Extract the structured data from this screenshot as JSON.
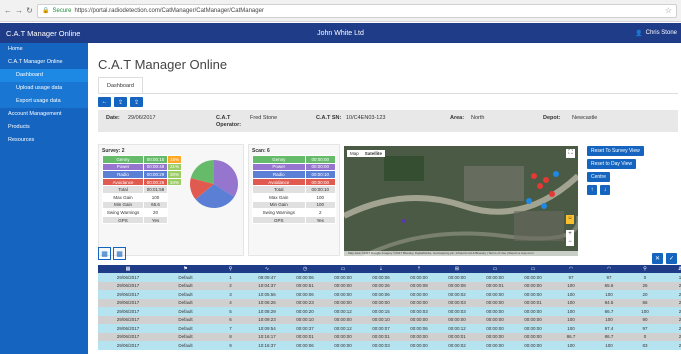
{
  "browser": {
    "secure_label": "Secure",
    "url": "https://portal.radiodetection.com/CatManager/CatManager/CatManager"
  },
  "topbar": {
    "brand": "C.A.T Manager Online",
    "center": "John White Ltd",
    "user": "Chris Stone"
  },
  "sidebar": {
    "items": [
      {
        "label": "Home",
        "level": 0,
        "active": false
      },
      {
        "label": "C.A.T Manager Online",
        "level": 0,
        "active": false
      },
      {
        "label": "Dashboard",
        "level": 1,
        "active": true
      },
      {
        "label": "Upload usage data",
        "level": 1,
        "active": false
      },
      {
        "label": "Export usage data",
        "level": 1,
        "active": false
      },
      {
        "label": "Account Management",
        "level": 0,
        "active": false
      },
      {
        "label": "Products",
        "level": 0,
        "active": false
      },
      {
        "label": "Resources",
        "level": 0,
        "active": false
      }
    ]
  },
  "page": {
    "title": "C.A.T Manager Online",
    "tab": "Dashboard"
  },
  "info": {
    "date_label": "Date:",
    "date": "29/06/2017",
    "operator_label": "C.A.T Operator:",
    "operator": "Fred Stone",
    "sn_label": "C.A.T SN:",
    "sn": "10/C4EN03-123",
    "area_label": "Area:",
    "area": "North",
    "depot_label": "Depot:",
    "depot": "Newcastle"
  },
  "survey": {
    "title": "Survey: 2",
    "modes": [
      {
        "name": "Genny",
        "time": "00:00:15",
        "pct": "15%"
      },
      {
        "name": "Power",
        "time": "00:00:48",
        "pct": "21%"
      },
      {
        "name": "Radio",
        "time": "00:00:29",
        "pct": "30%"
      },
      {
        "name": "Avoidance",
        "time": "00:00:26",
        "pct": "34%"
      }
    ],
    "stats": [
      {
        "label": "Total",
        "value": "00:01:58"
      },
      {
        "label": "Max Gain",
        "value": "100"
      },
      {
        "label": "Min Gain",
        "value": "65.6"
      },
      {
        "label": "Swing Warnings",
        "value": "20"
      },
      {
        "label": "GPS",
        "value": "Yes"
      }
    ],
    "pie": [
      {
        "color": "#9575cd",
        "fraction": 0.34
      },
      {
        "color": "#5c7fd6",
        "fraction": 0.3
      },
      {
        "color": "#e05a4f",
        "fraction": 0.15
      },
      {
        "color": "#66bb6a",
        "fraction": 0.21
      }
    ]
  },
  "scan": {
    "title": "Scan: 6",
    "rows": [
      {
        "label": "Genny",
        "value": "00:00:00",
        "color": "green"
      },
      {
        "label": "Power",
        "value": "00:00:00",
        "color": "purple"
      },
      {
        "label": "Radio",
        "value": "00:00:10",
        "color": "blue"
      },
      {
        "label": "Avoidance",
        "value": "00:00:00",
        "color": "red"
      },
      {
        "label": "Total",
        "value": "00:00:10",
        "color": "gray"
      },
      {
        "label": "Max Gain",
        "value": "100",
        "color": "white"
      },
      {
        "label": "Min Gain",
        "value": "100",
        "color": "gray"
      },
      {
        "label": "Swing Warnings",
        "value": "2",
        "color": "white"
      },
      {
        "label": "GPS",
        "value": "Yes",
        "color": "gray"
      }
    ]
  },
  "map": {
    "type_map": "Map",
    "type_satellite": "Satellite",
    "footer": "Map data ©2017 Google Imagery ©2017 Bluesky, DigitalGlobe, Getmapping plc, Infoterra Ltd & Bluesky | Terms of Use | Report a map error",
    "buttons": {
      "reset_survey": "Reset To Survey View",
      "reset_day": "Reset to Day View",
      "centre": "Centre"
    }
  },
  "table": {
    "columns": [
      "",
      "",
      "",
      "",
      "",
      "",
      "",
      "",
      "",
      "",
      "",
      "",
      "",
      "",
      ""
    ],
    "rows": [
      [
        "29/06/2017",
        "Default",
        "1",
        "09:09:47",
        "00:00:06",
        "00:00:00",
        "00:00:06",
        "00:00:00",
        "00:00:00",
        "00:00:00",
        "00:00:00",
        "97",
        "97",
        "0",
        "1"
      ],
      [
        "29/06/2017",
        "Default",
        "2",
        "10:04:37",
        "00:00:51",
        "00:00:00",
        "00:00:26",
        "00:00:08",
        "00:00:08",
        "00:00:01",
        "00:00:00",
        "100",
        "65.6",
        "25",
        "2"
      ],
      [
        "29/06/2017",
        "Default",
        "3",
        "10:05:56",
        "00:00:06",
        "00:00:00",
        "00:00:06",
        "00:00:00",
        "00:00:02",
        "00:00:00",
        "00:00:00",
        "100",
        "100",
        "20",
        "2"
      ],
      [
        "29/06/2017",
        "Default",
        "4",
        "10:06:26",
        "00:00:23",
        "00:00:00",
        "00:00:00",
        "00:00:00",
        "00:00:03",
        "00:00:00",
        "00:00:01",
        "100",
        "84.5",
        "66",
        "2"
      ],
      [
        "29/06/2017",
        "Default",
        "5",
        "10:08:29",
        "00:00:20",
        "00:00:12",
        "00:00:15",
        "00:00:03",
        "00:00:03",
        "00:00:00",
        "00:00:00",
        "100",
        "86.7",
        "100",
        "2"
      ],
      [
        "29/06/2017",
        "Default",
        "6",
        "10:09:23",
        "00:00:10",
        "00:00:00",
        "00:00:10",
        "00:00:00",
        "00:00:00",
        "00:00:00",
        "00:00:00",
        "100",
        "100",
        "90",
        "2"
      ],
      [
        "29/06/2017",
        "Default",
        "7",
        "10:09:54",
        "00:00:37",
        "00:00:12",
        "00:00:07",
        "00:00:06",
        "00:00:12",
        "00:00:00",
        "00:00:00",
        "100",
        "97.4",
        "97",
        "2"
      ],
      [
        "29/06/2017",
        "Default",
        "8",
        "10:16:17",
        "00:00:01",
        "00:00:00",
        "00:00:01",
        "00:00:00",
        "00:00:01",
        "00:00:00",
        "00:00:00",
        "86.7",
        "86.7",
        "0",
        "2"
      ],
      [
        "29/06/2017",
        "Default",
        "9",
        "10:16:37",
        "00:00:06",
        "00:00:00",
        "00:00:03",
        "00:00:00",
        "00:00:02",
        "00:00:00",
        "00:00:00",
        "100",
        "100",
        "83",
        "2"
      ]
    ]
  }
}
